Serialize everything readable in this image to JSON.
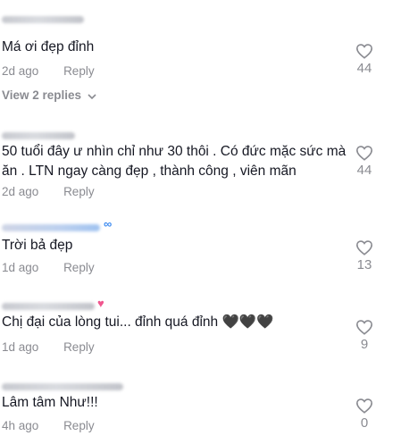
{
  "comments": [
    {
      "text": "Má ơi đẹp đỉnh",
      "time": "2d ago",
      "reply": "Reply",
      "likes": "44"
    },
    {
      "text": "50 tuổi đây ư nhìn chỉ như 30 thôi . Có đức mặc sức mà ăn . LTN ngay càng đẹp , thành công , viên mãn",
      "time": "2d ago",
      "reply": "Reply",
      "likes": "44"
    },
    {
      "text": "Trời bả đẹp",
      "time": "1d ago",
      "reply": "Reply",
      "likes": "13"
    },
    {
      "text": "Chị đại của lòng tui... đỉnh quá đỉnh 🖤🖤🖤",
      "time": "1d ago",
      "reply": "Reply",
      "likes": "9"
    },
    {
      "text": "Lâm tâm Như!!!",
      "time": "4h ago",
      "reply": "Reply",
      "likes": "0"
    }
  ],
  "view_replies": "View 2 replies",
  "colors": {
    "text": "#161823",
    "muted": "#8a8b91",
    "background": "#ffffff"
  },
  "icons": {
    "like": "heart-outline-icon",
    "expand": "chevron-down-icon"
  }
}
